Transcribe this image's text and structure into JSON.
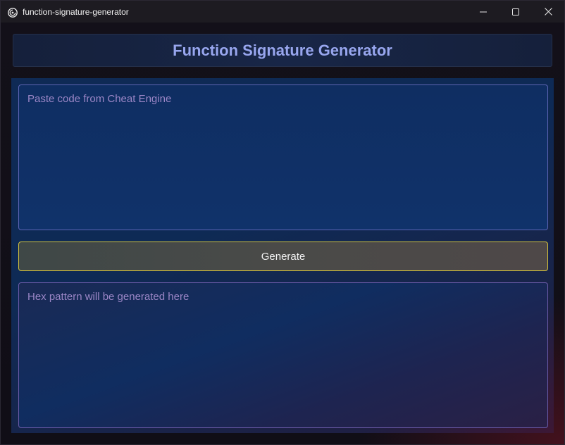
{
  "window": {
    "title": "function-signature-generator",
    "app_icon": "app-swirl-icon",
    "controls": [
      "minimize-icon",
      "maximize-icon",
      "close-icon"
    ]
  },
  "header": {
    "title": "Function Signature Generator"
  },
  "input": {
    "value": "",
    "placeholder": "Paste code from Cheat Engine"
  },
  "generate_button": {
    "label": "Generate"
  },
  "output": {
    "value": "",
    "placeholder": "Hex pattern will be generated here"
  },
  "colors": {
    "title_text": "#98a6ee",
    "button_border": "#d4c23c",
    "field_border": "#6a5fb0",
    "placeholder": "#9b86c6"
  }
}
